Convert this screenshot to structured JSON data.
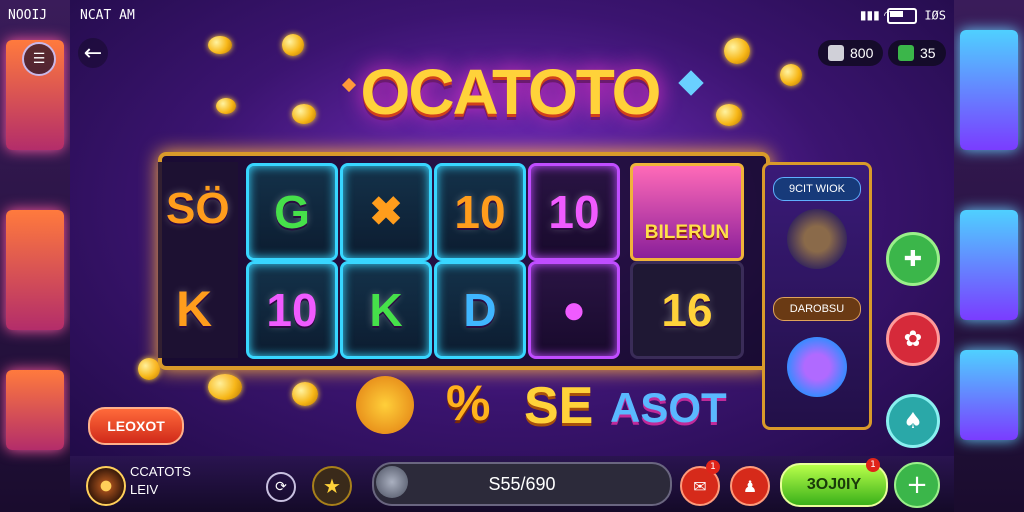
{
  "status_bar": {
    "left_text": "NOOIJ",
    "time_text": "NCAT AM",
    "battery_text": "IØS",
    "battery_level_percent": 60
  },
  "header": {
    "game_logo_text": "OCATOTO",
    "back_icon": "back-arrow-icon",
    "menu_icon": "menu-icon",
    "currency_1": {
      "value": "800",
      "icon": "coin-stack-icon"
    },
    "currency_2": {
      "value": "35",
      "icon": "green-ticket-icon"
    }
  },
  "reels": {
    "left_column": [
      "SÖ",
      "K"
    ],
    "row1": [
      "G",
      "cross-bone-creature-icon",
      "10",
      "10"
    ],
    "row2": [
      "10",
      "K",
      "D",
      "berry-icon"
    ],
    "special_tile": {
      "label": "BILERUN"
    },
    "extra_row2_symbol": "16"
  },
  "side_panel": {
    "tag_1": "9CIT WIOK",
    "tag_2": "DAROBSU",
    "creature_1": "bunny-mask-icon",
    "creature_2": "robot-face-icon"
  },
  "right_buttons": [
    {
      "name": "puzzle-button",
      "icon": "puzzle-icon",
      "color": "#3bb64a"
    },
    {
      "name": "flower-button",
      "icon": "flower-icon",
      "color": "#d62a3a"
    },
    {
      "name": "leaf-button",
      "icon": "leaf-icon",
      "color": "#2aa8a8"
    }
  ],
  "lock_button": {
    "label": "LEOXOT"
  },
  "win_row": {
    "symbol_1": "goggles-creature-icon",
    "symbol_2": "%",
    "word_1": "SE",
    "word_2": "ASOT"
  },
  "bottom_bar": {
    "player_name": "CCATOTS",
    "player_level": "LEIV",
    "balance": "S55/690",
    "spin_label": "3OJ0IY",
    "badge_1": "1",
    "badge_2": "1"
  },
  "colors": {
    "accent_gold": "#d99a2a",
    "reel_glow": "#38d6ff",
    "spin_green": "#3ab01a"
  }
}
